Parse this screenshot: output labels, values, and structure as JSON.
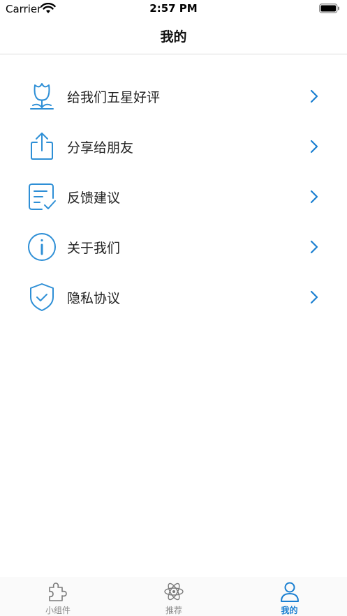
{
  "status_bar": {
    "carrier": "Carrier",
    "time": "2:57 PM"
  },
  "nav": {
    "title": "我的"
  },
  "menu": [
    {
      "label": "给我们五星好评",
      "icon": "tulip-icon"
    },
    {
      "label": "分享给朋友",
      "icon": "share-icon"
    },
    {
      "label": "反馈建议",
      "icon": "feedback-icon"
    },
    {
      "label": "关于我们",
      "icon": "info-icon"
    },
    {
      "label": "隐私协议",
      "icon": "shield-check-icon"
    }
  ],
  "tabs": [
    {
      "label": "小组件",
      "icon": "puzzle-icon",
      "active": false
    },
    {
      "label": "推荐",
      "icon": "atom-icon",
      "active": false
    },
    {
      "label": "我的",
      "icon": "person-icon",
      "active": true
    }
  ],
  "colors": {
    "accent": "#1a7fd1",
    "icon_blue": "#2e8fd6",
    "inactive": "#888888"
  }
}
